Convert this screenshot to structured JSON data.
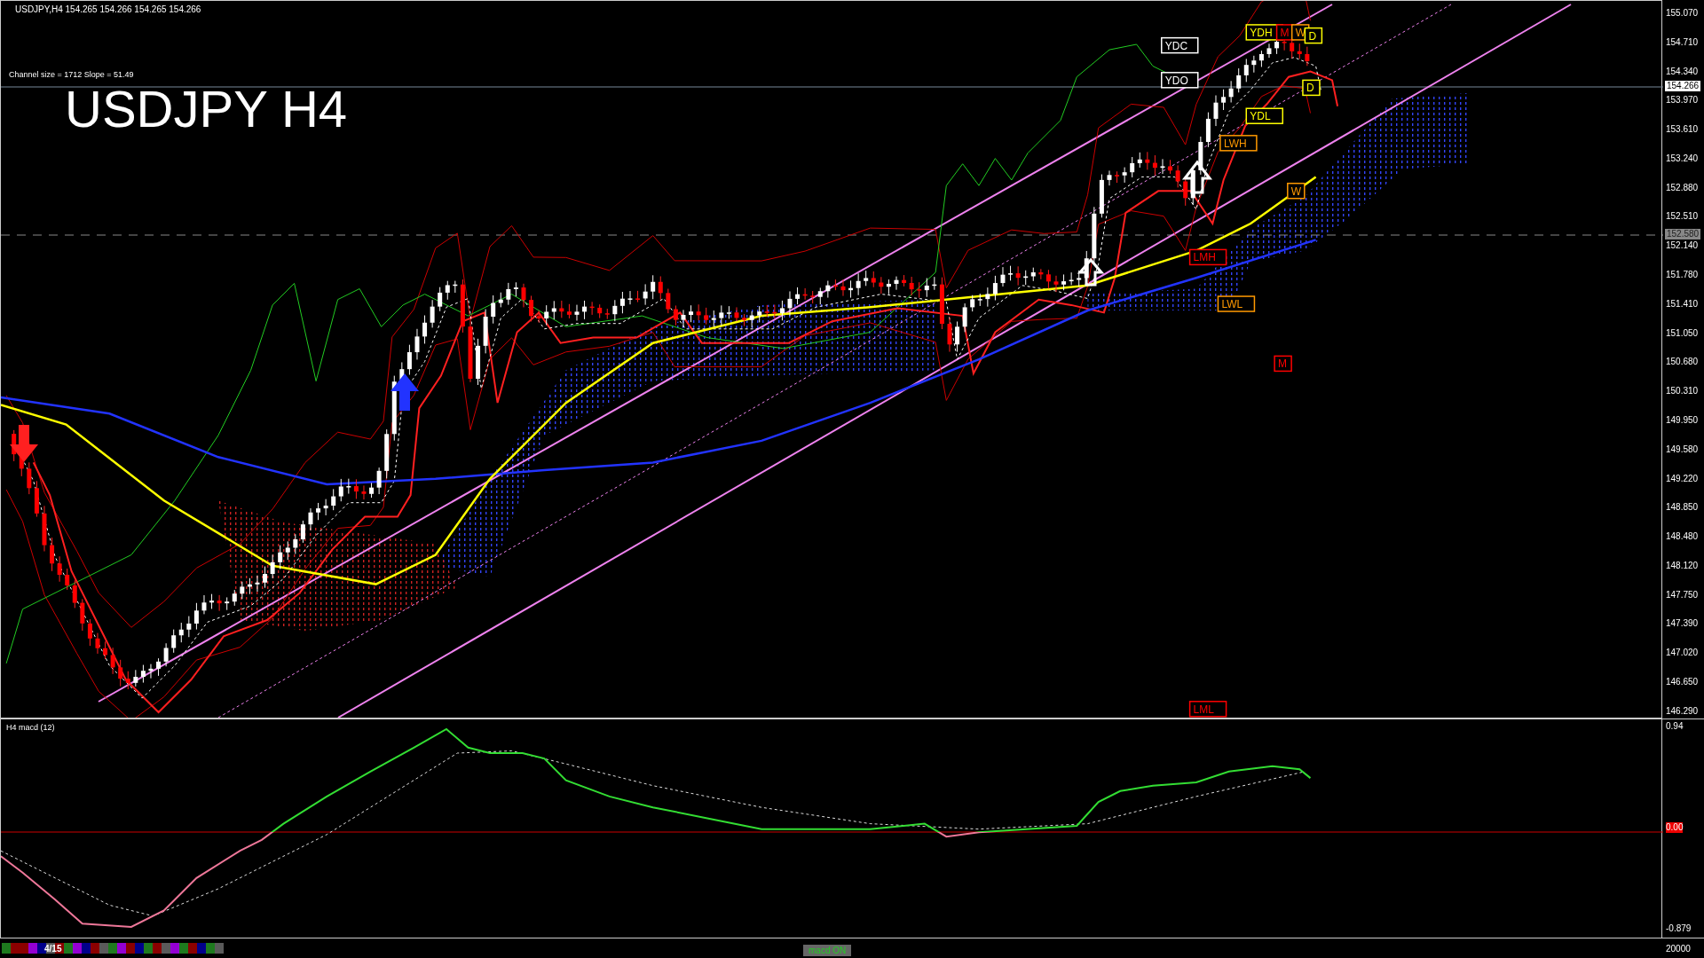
{
  "chart": {
    "symbol_line": "USDJPY,H4  154.265 154.266 154.265 154.266",
    "channel_info": "Channel size = 1712 Slope = 51.49",
    "title": "USDJPY H4",
    "level_labels": [
      {
        "text": "YDH",
        "color": "#ffff00"
      },
      {
        "text": "M",
        "color": "#ff0000"
      },
      {
        "text": "W",
        "color": "#ff9900"
      },
      {
        "text": "D",
        "color": "#ffff00"
      },
      {
        "text": "YDC",
        "color": "#ffffff"
      },
      {
        "text": "YDO",
        "color": "#ffffff"
      },
      {
        "text": "D",
        "color": "#ffff00"
      },
      {
        "text": "YDL",
        "color": "#ffff00"
      },
      {
        "text": "LWH",
        "color": "#ff9900"
      },
      {
        "text": "W",
        "color": "#ff9900"
      },
      {
        "text": "LMH",
        "color": "#ff0000"
      },
      {
        "text": "LWL",
        "color": "#ff9900"
      },
      {
        "text": "M",
        "color": "#ff0000"
      },
      {
        "text": "LML",
        "color": "#ff0000"
      }
    ]
  },
  "price_axis": {
    "ticks": [
      "155.070",
      "154.710",
      "154.340",
      "153.970",
      "153.610",
      "153.240",
      "152.880",
      "152.510",
      "152.140",
      "151.780",
      "151.410",
      "151.050",
      "150.680",
      "150.310",
      "149.950",
      "149.580",
      "149.220",
      "148.850",
      "148.480",
      "148.120",
      "147.750",
      "147.390",
      "147.020",
      "146.650",
      "146.290"
    ],
    "current_price": "154.266",
    "reference_price": "152.580"
  },
  "macd": {
    "label": "H4  macd (12)",
    "ticks": [
      "0.94",
      "0.00",
      "-0.879"
    ]
  },
  "bottom_bar": {
    "page": "4/15",
    "toggle": "macd ON",
    "volume": "20000"
  }
}
